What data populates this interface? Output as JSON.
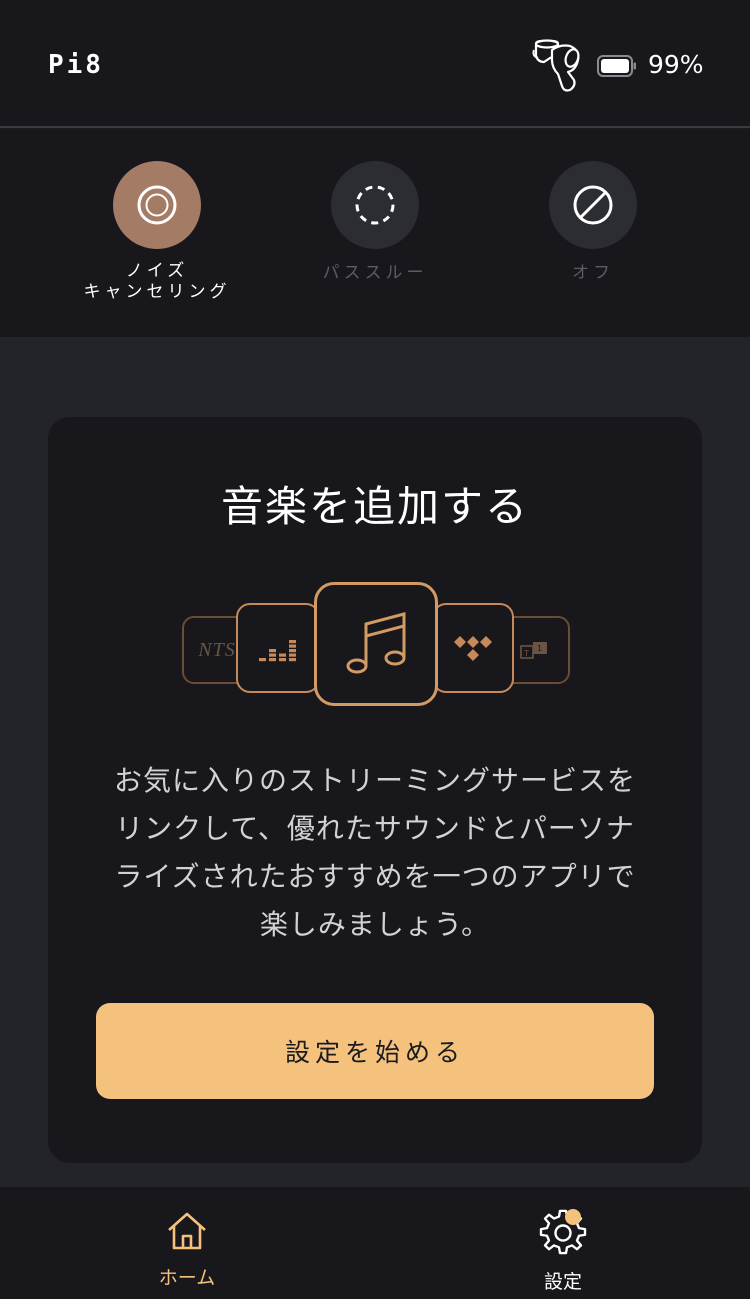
{
  "header": {
    "device_name": "Pi8",
    "battery_percent": "99%",
    "battery_level": 0.99
  },
  "modes": [
    {
      "label": "ノイズ\nキャンセリング",
      "icon": "anc-icon",
      "active": true
    },
    {
      "label": "パススルー",
      "icon": "passthrough-icon",
      "active": false
    },
    {
      "label": "オフ",
      "icon": "off-icon",
      "active": false
    }
  ],
  "card": {
    "title": "音楽を追加する",
    "body": "お気に入りのストリーミングサービスをリンクして、優れたサウンドとパーソナライズされたおすすめを一つのアプリで楽しみましょう。",
    "cta_label": "設定を始める",
    "services": [
      {
        "name": "NTS",
        "icon": "nts-logo"
      },
      {
        "name": "deezer",
        "icon": "deezer-icon"
      },
      {
        "name": "music",
        "icon": "music-note-icon"
      },
      {
        "name": "tidal",
        "icon": "tidal-icon"
      },
      {
        "name": "other",
        "icon": "other-service-icon"
      }
    ]
  },
  "nav": {
    "home_label": "ホーム",
    "settings_label": "設定"
  },
  "colors": {
    "accent": "#f4c27c",
    "active_mode": "#a47c66",
    "copper": "#c7895a",
    "background": "#17171c",
    "panel": "#23232a"
  }
}
